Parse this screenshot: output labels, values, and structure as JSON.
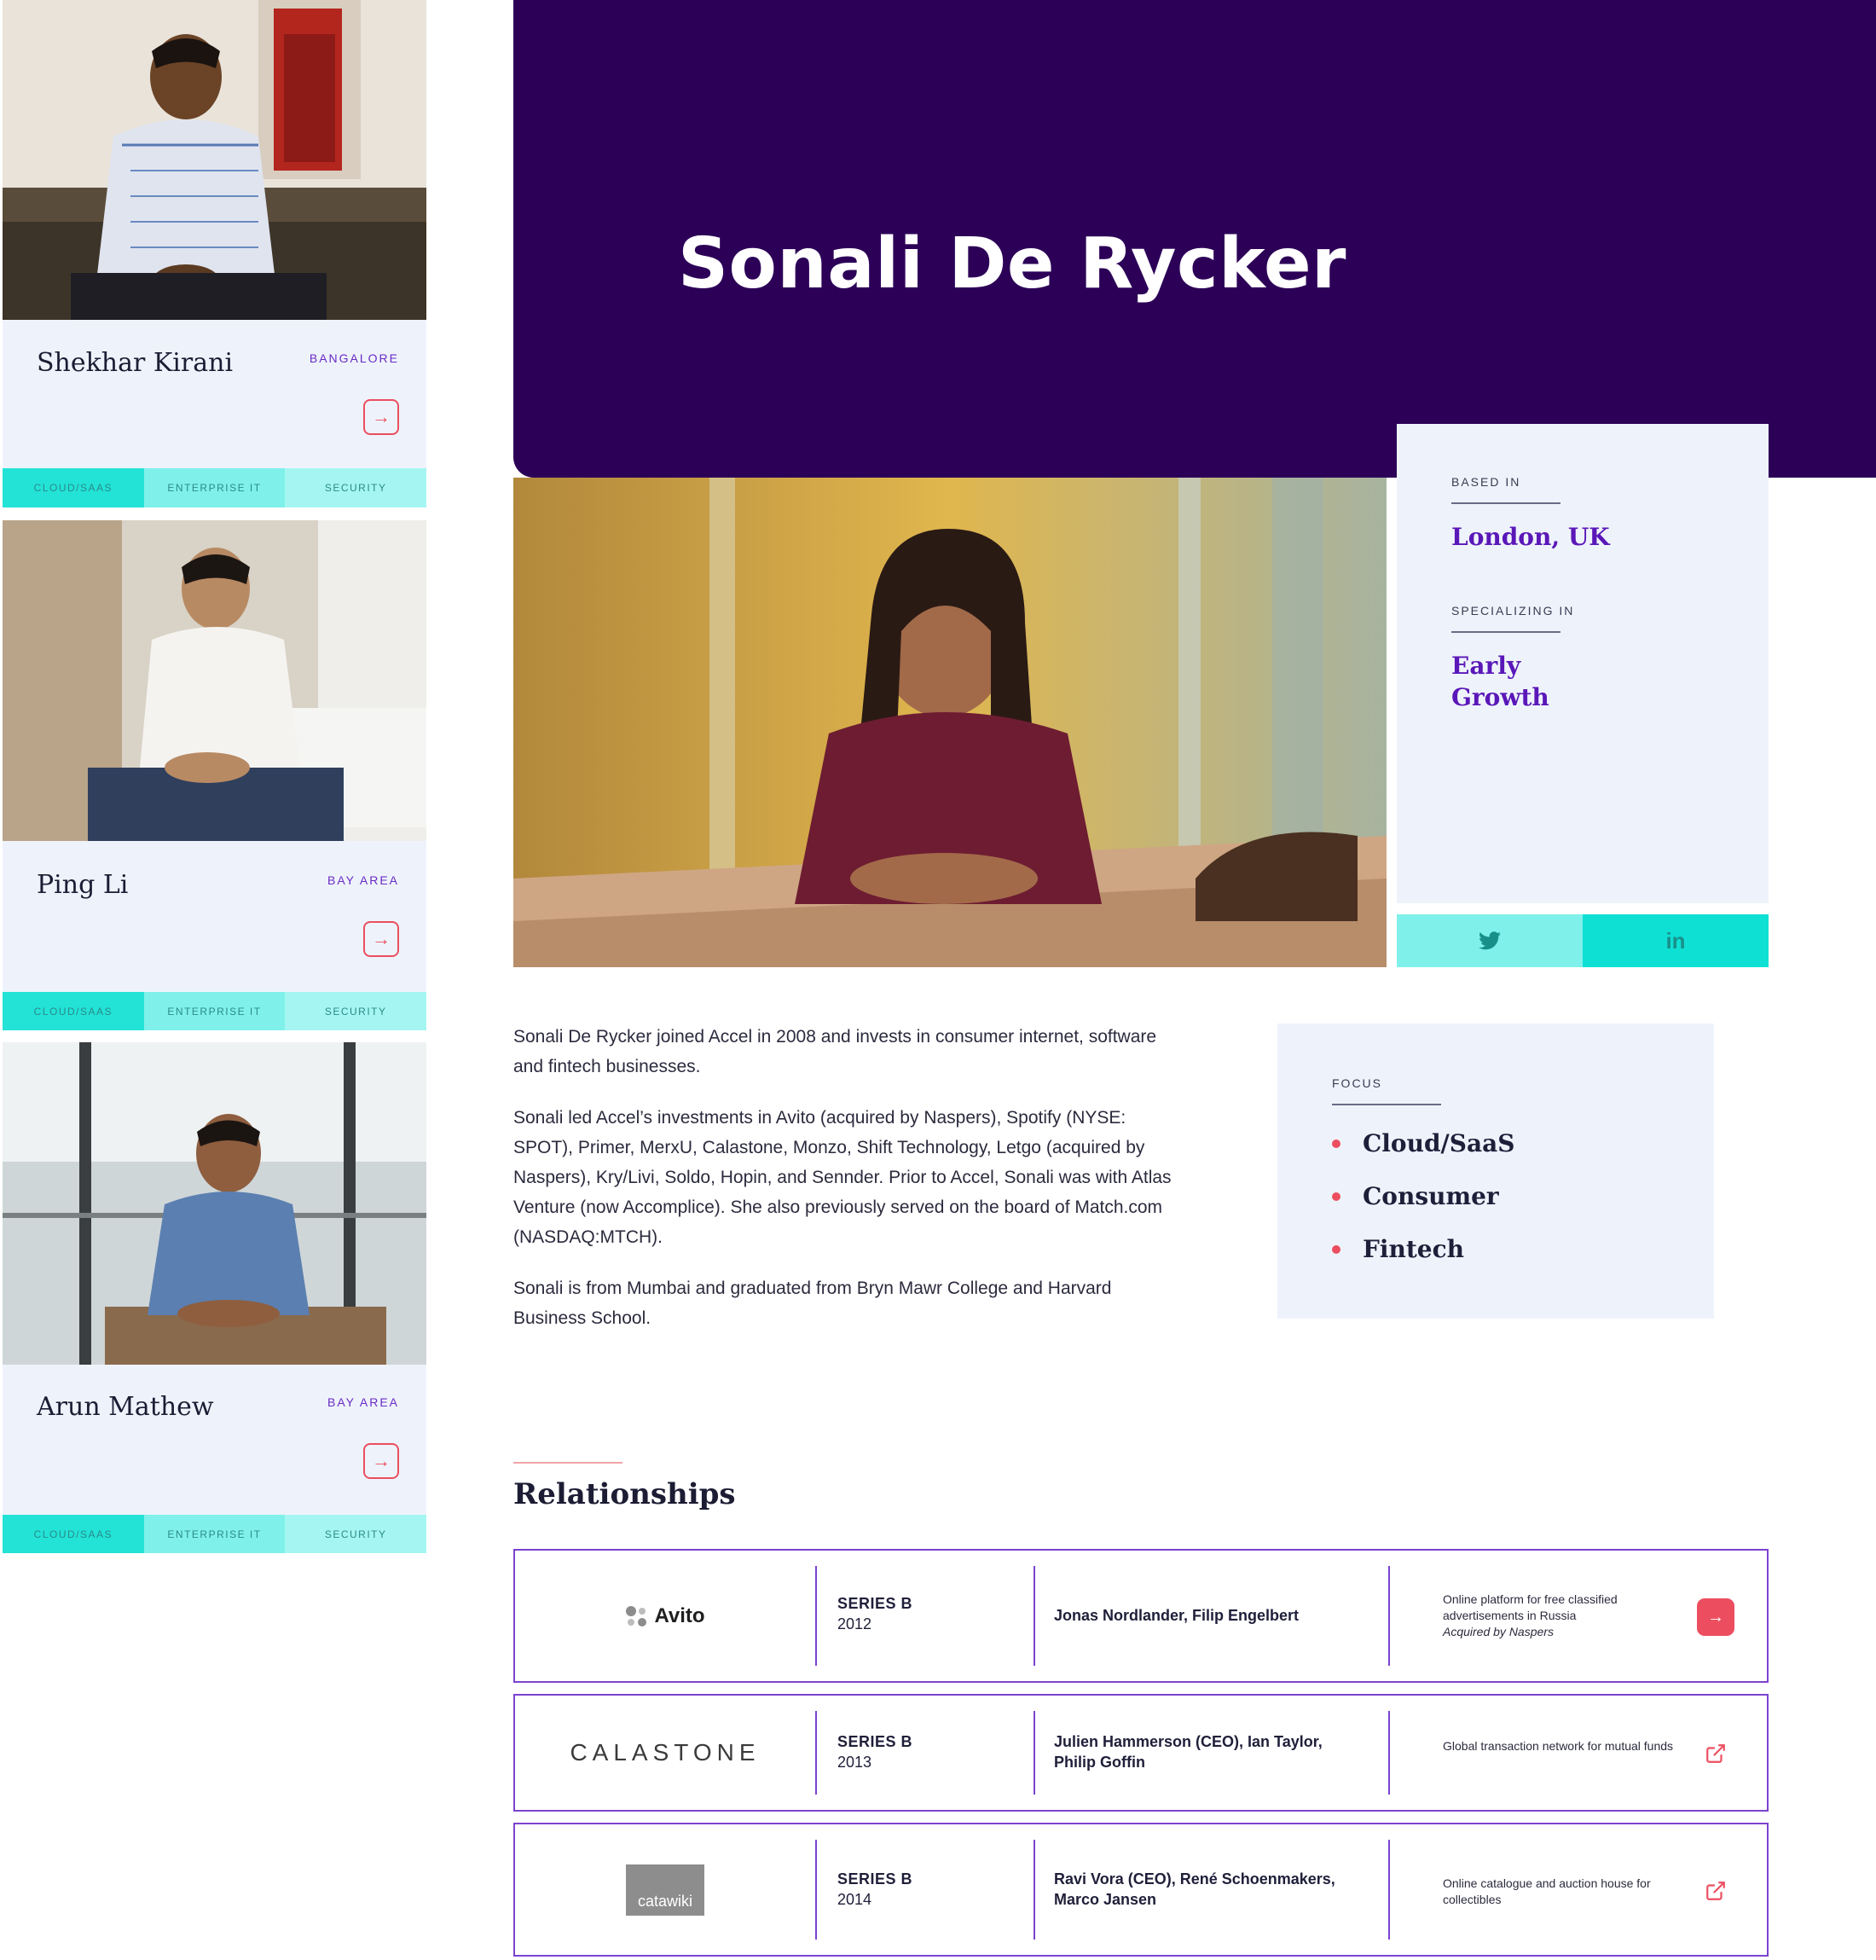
{
  "team_cards": [
    {
      "name": "Shekhar Kirani",
      "location": "BANGALORE",
      "tags": [
        "CLOUD/SAAS",
        "ENTERPRISE IT",
        "SECURITY"
      ]
    },
    {
      "name": "Ping Li",
      "location": "BAY AREA",
      "tags": [
        "CLOUD/SAAS",
        "ENTERPRISE IT",
        "SECURITY"
      ]
    },
    {
      "name": "Arun Mathew",
      "location": "BAY AREA",
      "tags": [
        "CLOUD/SAAS",
        "ENTERPRISE IT",
        "SECURITY"
      ]
    }
  ],
  "profile": {
    "name": "Sonali De Rycker",
    "based_in_label": "BASED IN",
    "based_in": "London, UK",
    "specializing_label": "SPECIALIZING IN",
    "specializing_line1": "Early",
    "specializing_line2": "Growth"
  },
  "social": {
    "twitter_icon": "twitter-icon",
    "linkedin_label": "in"
  },
  "bio": [
    "Sonali De Rycker joined Accel in 2008 and invests in consumer internet, software and fintech businesses.",
    "Sonali led Accel’s investments in Avito (acquired by Naspers), Spotify (NYSE: SPOT), Primer, MerxU, Calastone, Monzo, Shift Technology, Letgo (acquired by Naspers), Kry/Livi, Soldo, Hopin, and Sennder. Prior to Accel, Sonali was with Atlas Venture (now Accomplice). She also previously served on the board of Match.com (NASDAQ:MTCH).",
    "Sonali is from Mumbai and graduated from Bryn Mawr College and Harvard Business School."
  ],
  "focus": {
    "label": "FOCUS",
    "items": [
      "Cloud/SaaS",
      "Consumer",
      "Fintech"
    ]
  },
  "relationships": {
    "title": "Relationships",
    "rows": [
      {
        "logo_text": "Avito",
        "series": "SERIES B",
        "year": "2012",
        "people": "Jonas Nordlander, Filip Engelbert",
        "desc": "Online platform for free classified advertisements in Russia",
        "note": "Acquired by Naspers"
      },
      {
        "logo_text": "CALASTONE",
        "series": "SERIES B",
        "year": "2013",
        "people": "Julien Hammerson (CEO), Ian Taylor, Philip Goffin",
        "desc": "Global transaction network for mutual funds",
        "note": ""
      },
      {
        "logo_text": "catawiki",
        "series": "SERIES B",
        "year": "2014",
        "people": "Ravi Vora (CEO), René Schoenmakers, Marco Jansen",
        "desc": "Online catalogue and auction house for collectibles",
        "note": ""
      }
    ]
  },
  "colors": {
    "hero": "#2c0057",
    "accent_purple": "#5a17b8",
    "accent_red": "#ec4e5f",
    "teal": "#0fe0d4",
    "panel": "#eef3fb"
  }
}
